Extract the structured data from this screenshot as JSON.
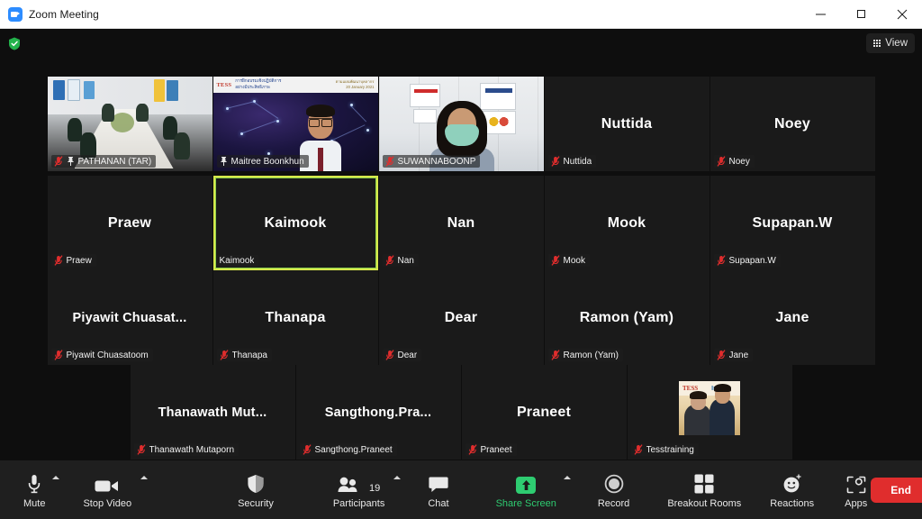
{
  "window": {
    "title": "Zoom Meeting",
    "app_icon": "zoom-logo-icon",
    "minimize_label": "Minimize",
    "maximize_label": "Maximize",
    "close_label": "Close"
  },
  "topbar": {
    "encryption_icon": "green-shield-icon",
    "view_label": "View",
    "view_icon": "grid-icon"
  },
  "grid": {
    "rows": [
      {
        "tiles": [
          {
            "display_name": "",
            "name_label": "PATHANAN (TAR)",
            "video": "room",
            "muted": true,
            "pinned": true,
            "active_speaker": false
          },
          {
            "display_name": "",
            "name_label": "Maitree Boonkhun",
            "video": "presenter",
            "muted": false,
            "pinned": true,
            "active_speaker": false,
            "background_banner": {
              "logo": "TESS",
              "line1_th": "การฝึกอบรมเชิงปฏิบัติการ",
              "line2_th": "อย่างมีประสิทธิภาพ",
              "date_th": "ตามแผนพัฒนาบุคลากร",
              "date_en": "20 January 2021"
            }
          },
          {
            "display_name": "",
            "name_label": "SUWANNABOONP",
            "video": "masked",
            "muted": true,
            "pinned": false,
            "active_speaker": false
          },
          {
            "display_name": "Nuttida",
            "name_label": "Nuttida",
            "video": "none",
            "muted": true,
            "pinned": false,
            "active_speaker": false
          },
          {
            "display_name": "Noey",
            "name_label": "Noey",
            "video": "none",
            "muted": true,
            "pinned": false,
            "active_speaker": false
          }
        ]
      },
      {
        "tiles": [
          {
            "display_name": "Praew",
            "name_label": "Praew",
            "video": "none",
            "muted": true,
            "pinned": false,
            "active_speaker": false
          },
          {
            "display_name": "Kaimook",
            "name_label": "Kaimook",
            "video": "none",
            "muted": false,
            "pinned": false,
            "active_speaker": true
          },
          {
            "display_name": "Nan",
            "name_label": "Nan",
            "video": "none",
            "muted": true,
            "pinned": false,
            "active_speaker": false
          },
          {
            "display_name": "Mook",
            "name_label": "Mook",
            "video": "none",
            "muted": true,
            "pinned": false,
            "active_speaker": false
          },
          {
            "display_name": "Supapan.W",
            "name_label": "Supapan.W",
            "video": "none",
            "muted": true,
            "pinned": false,
            "active_speaker": false
          }
        ]
      },
      {
        "tiles": [
          {
            "display_name": "Piyawit  Chuasat...",
            "name_label": "Piyawit Chuasatoom",
            "video": "none",
            "muted": true,
            "pinned": false,
            "active_speaker": false
          },
          {
            "display_name": "Thanapa",
            "name_label": "Thanapa",
            "video": "none",
            "muted": true,
            "pinned": false,
            "active_speaker": false
          },
          {
            "display_name": "Dear",
            "name_label": "Dear",
            "video": "none",
            "muted": true,
            "pinned": false,
            "active_speaker": false
          },
          {
            "display_name": "Ramon (Yam)",
            "name_label": "Ramon (Yam)",
            "video": "none",
            "muted": true,
            "pinned": false,
            "active_speaker": false
          },
          {
            "display_name": "Jane",
            "name_label": "Jane",
            "video": "none",
            "muted": true,
            "pinned": false,
            "active_speaker": false
          }
        ]
      },
      {
        "tiles": [
          {
            "display_name": "Thanawath  Mut...",
            "name_label": "Thanawath Mutaporn",
            "video": "none",
            "muted": true,
            "pinned": false,
            "active_speaker": false
          },
          {
            "display_name": "Sangthong.Pra...",
            "name_label": "Sangthong.Praneet",
            "video": "none",
            "muted": true,
            "pinned": false,
            "active_speaker": false
          },
          {
            "display_name": "Praneet",
            "name_label": "Praneet",
            "video": "none",
            "muted": true,
            "pinned": false,
            "active_speaker": false
          },
          {
            "display_name": "",
            "name_label": "Tesstraining",
            "video": "avatar",
            "muted": true,
            "pinned": false,
            "active_speaker": false,
            "avatar": {
              "logo": "TESS",
              "text": "In H"
            }
          }
        ]
      }
    ]
  },
  "toolbar": {
    "mute": {
      "label": "Mute",
      "icon": "microphone-icon",
      "has_caret": true
    },
    "video": {
      "label": "Stop Video",
      "icon": "camera-icon",
      "has_caret": true
    },
    "security": {
      "label": "Security",
      "icon": "shield-icon",
      "has_caret": false
    },
    "participants": {
      "label": "Participants",
      "icon": "people-icon",
      "count": "19",
      "has_caret": true
    },
    "chat": {
      "label": "Chat",
      "icon": "chat-bubble-icon",
      "has_caret": false
    },
    "share": {
      "label": "Share Screen",
      "icon": "share-arrow-up-icon",
      "has_caret": true,
      "accent": "#2ecc71"
    },
    "record": {
      "label": "Record",
      "icon": "record-circle-icon",
      "has_caret": false
    },
    "breakout": {
      "label": "Breakout Rooms",
      "icon": "grid-squares-icon",
      "has_caret": false
    },
    "reactions": {
      "label": "Reactions",
      "icon": "smiley-icon",
      "has_caret": false
    },
    "apps": {
      "label": "Apps",
      "icon": "apps-bracket-icon",
      "has_caret": false
    },
    "end": {
      "label": "End",
      "color": "#e02d2d"
    }
  },
  "colors": {
    "accent_green": "#2ecc71",
    "active_speaker_border": "#d7e84b",
    "end_red": "#e02d2d",
    "stage_bg": "#0e0e0e",
    "tile_bg": "#1a1a1a",
    "toolbar_bg": "#1f1f1f"
  }
}
